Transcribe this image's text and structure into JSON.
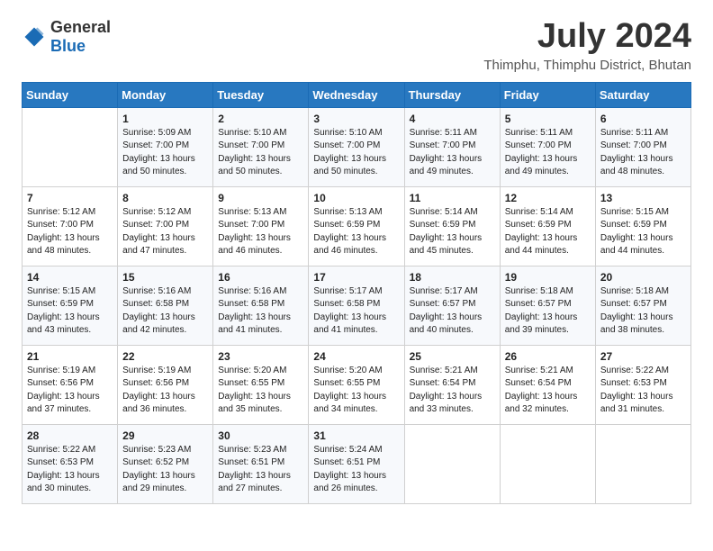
{
  "logo": {
    "general": "General",
    "blue": "Blue"
  },
  "title": "July 2024",
  "location": "Thimphu, Thimphu District, Bhutan",
  "days_of_week": [
    "Sunday",
    "Monday",
    "Tuesday",
    "Wednesday",
    "Thursday",
    "Friday",
    "Saturday"
  ],
  "weeks": [
    [
      {
        "day": "",
        "info": ""
      },
      {
        "day": "1",
        "info": "Sunrise: 5:09 AM\nSunset: 7:00 PM\nDaylight: 13 hours\nand 50 minutes."
      },
      {
        "day": "2",
        "info": "Sunrise: 5:10 AM\nSunset: 7:00 PM\nDaylight: 13 hours\nand 50 minutes."
      },
      {
        "day": "3",
        "info": "Sunrise: 5:10 AM\nSunset: 7:00 PM\nDaylight: 13 hours\nand 50 minutes."
      },
      {
        "day": "4",
        "info": "Sunrise: 5:11 AM\nSunset: 7:00 PM\nDaylight: 13 hours\nand 49 minutes."
      },
      {
        "day": "5",
        "info": "Sunrise: 5:11 AM\nSunset: 7:00 PM\nDaylight: 13 hours\nand 49 minutes."
      },
      {
        "day": "6",
        "info": "Sunrise: 5:11 AM\nSunset: 7:00 PM\nDaylight: 13 hours\nand 48 minutes."
      }
    ],
    [
      {
        "day": "7",
        "info": "Sunrise: 5:12 AM\nSunset: 7:00 PM\nDaylight: 13 hours\nand 48 minutes."
      },
      {
        "day": "8",
        "info": "Sunrise: 5:12 AM\nSunset: 7:00 PM\nDaylight: 13 hours\nand 47 minutes."
      },
      {
        "day": "9",
        "info": "Sunrise: 5:13 AM\nSunset: 7:00 PM\nDaylight: 13 hours\nand 46 minutes."
      },
      {
        "day": "10",
        "info": "Sunrise: 5:13 AM\nSunset: 6:59 PM\nDaylight: 13 hours\nand 46 minutes."
      },
      {
        "day": "11",
        "info": "Sunrise: 5:14 AM\nSunset: 6:59 PM\nDaylight: 13 hours\nand 45 minutes."
      },
      {
        "day": "12",
        "info": "Sunrise: 5:14 AM\nSunset: 6:59 PM\nDaylight: 13 hours\nand 44 minutes."
      },
      {
        "day": "13",
        "info": "Sunrise: 5:15 AM\nSunset: 6:59 PM\nDaylight: 13 hours\nand 44 minutes."
      }
    ],
    [
      {
        "day": "14",
        "info": "Sunrise: 5:15 AM\nSunset: 6:59 PM\nDaylight: 13 hours\nand 43 minutes."
      },
      {
        "day": "15",
        "info": "Sunrise: 5:16 AM\nSunset: 6:58 PM\nDaylight: 13 hours\nand 42 minutes."
      },
      {
        "day": "16",
        "info": "Sunrise: 5:16 AM\nSunset: 6:58 PM\nDaylight: 13 hours\nand 41 minutes."
      },
      {
        "day": "17",
        "info": "Sunrise: 5:17 AM\nSunset: 6:58 PM\nDaylight: 13 hours\nand 41 minutes."
      },
      {
        "day": "18",
        "info": "Sunrise: 5:17 AM\nSunset: 6:57 PM\nDaylight: 13 hours\nand 40 minutes."
      },
      {
        "day": "19",
        "info": "Sunrise: 5:18 AM\nSunset: 6:57 PM\nDaylight: 13 hours\nand 39 minutes."
      },
      {
        "day": "20",
        "info": "Sunrise: 5:18 AM\nSunset: 6:57 PM\nDaylight: 13 hours\nand 38 minutes."
      }
    ],
    [
      {
        "day": "21",
        "info": "Sunrise: 5:19 AM\nSunset: 6:56 PM\nDaylight: 13 hours\nand 37 minutes."
      },
      {
        "day": "22",
        "info": "Sunrise: 5:19 AM\nSunset: 6:56 PM\nDaylight: 13 hours\nand 36 minutes."
      },
      {
        "day": "23",
        "info": "Sunrise: 5:20 AM\nSunset: 6:55 PM\nDaylight: 13 hours\nand 35 minutes."
      },
      {
        "day": "24",
        "info": "Sunrise: 5:20 AM\nSunset: 6:55 PM\nDaylight: 13 hours\nand 34 minutes."
      },
      {
        "day": "25",
        "info": "Sunrise: 5:21 AM\nSunset: 6:54 PM\nDaylight: 13 hours\nand 33 minutes."
      },
      {
        "day": "26",
        "info": "Sunrise: 5:21 AM\nSunset: 6:54 PM\nDaylight: 13 hours\nand 32 minutes."
      },
      {
        "day": "27",
        "info": "Sunrise: 5:22 AM\nSunset: 6:53 PM\nDaylight: 13 hours\nand 31 minutes."
      }
    ],
    [
      {
        "day": "28",
        "info": "Sunrise: 5:22 AM\nSunset: 6:53 PM\nDaylight: 13 hours\nand 30 minutes."
      },
      {
        "day": "29",
        "info": "Sunrise: 5:23 AM\nSunset: 6:52 PM\nDaylight: 13 hours\nand 29 minutes."
      },
      {
        "day": "30",
        "info": "Sunrise: 5:23 AM\nSunset: 6:51 PM\nDaylight: 13 hours\nand 27 minutes."
      },
      {
        "day": "31",
        "info": "Sunrise: 5:24 AM\nSunset: 6:51 PM\nDaylight: 13 hours\nand 26 minutes."
      },
      {
        "day": "",
        "info": ""
      },
      {
        "day": "",
        "info": ""
      },
      {
        "day": "",
        "info": ""
      }
    ]
  ]
}
